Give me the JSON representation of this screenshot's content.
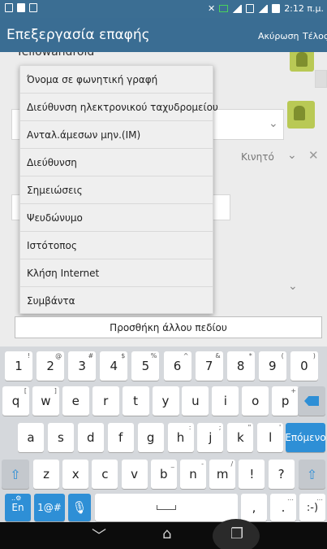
{
  "action_bar": {
    "title": "Επεξεργασία επαφής",
    "cancel_label": "Ακύρωση",
    "done_label": "Τέλος"
  },
  "status_bar": {
    "time": "2:12 π.μ."
  },
  "background": {
    "account_text": "Yellowandroid",
    "phone_type": "Κινητό"
  },
  "menu": {
    "items": [
      "Όνομα σε φωνητική γραφή",
      "Διεύθυνση ηλεκτρονικού ταχυδρομείου",
      "Ανταλ.άμεσων μην.(IM)",
      "Διεύθυνση",
      "Σημειώσεις",
      "Ψευδώνυμο",
      "Ιστότοπος",
      "Κλήση Internet",
      "Συμβάντα"
    ]
  },
  "add_field_label": "Προσθήκη άλλου πεδίου",
  "keyboard": {
    "number_row": [
      {
        "key": "1",
        "hint": "!"
      },
      {
        "key": "2",
        "hint": "@"
      },
      {
        "key": "3",
        "hint": "#"
      },
      {
        "key": "4",
        "hint": "$"
      },
      {
        "key": "5",
        "hint": "%"
      },
      {
        "key": "6",
        "hint": "^"
      },
      {
        "key": "7",
        "hint": "&"
      },
      {
        "key": "8",
        "hint": "*"
      },
      {
        "key": "9",
        "hint": "("
      },
      {
        "key": "0",
        "hint": ")"
      }
    ],
    "row1": [
      {
        "key": "q",
        "hint": "["
      },
      {
        "key": "w",
        "hint": "]"
      },
      {
        "key": "e",
        "hint": ""
      },
      {
        "key": "r",
        "hint": ""
      },
      {
        "key": "t",
        "hint": ""
      },
      {
        "key": "y",
        "hint": ""
      },
      {
        "key": "u",
        "hint": ""
      },
      {
        "key": "i",
        "hint": ""
      },
      {
        "key": "o",
        "hint": ""
      },
      {
        "key": "p",
        "hint": "+"
      }
    ],
    "row2": [
      {
        "key": "a",
        "hint": ""
      },
      {
        "key": "s",
        "hint": ""
      },
      {
        "key": "d",
        "hint": ""
      },
      {
        "key": "f",
        "hint": ""
      },
      {
        "key": "g",
        "hint": ""
      },
      {
        "key": "h",
        "hint": ":"
      },
      {
        "key": "j",
        "hint": ";"
      },
      {
        "key": "k",
        "hint": "\""
      },
      {
        "key": "l",
        "hint": "'"
      }
    ],
    "row3": [
      {
        "key": "z",
        "hint": ""
      },
      {
        "key": "x",
        "hint": ""
      },
      {
        "key": "c",
        "hint": ""
      },
      {
        "key": "v",
        "hint": ""
      },
      {
        "key": "b",
        "hint": "_"
      },
      {
        "key": "n",
        "hint": "-"
      },
      {
        "key": "m",
        "hint": "/"
      },
      {
        "key": "!",
        "hint": ""
      },
      {
        "key": "?",
        "hint": ""
      }
    ],
    "enter_label": "Επόμενο",
    "lang_label": "En",
    "symbols_label": "1@#",
    "comma_label": ",",
    "period_label": ".",
    "smiley_label": ":-)",
    "backspace_icon": "backspace-icon",
    "shift_icon": "shift-icon",
    "mic_icon": "microphone-icon"
  },
  "colors": {
    "action_bar": "#3a6d93",
    "accent": "#2e8fd6"
  }
}
